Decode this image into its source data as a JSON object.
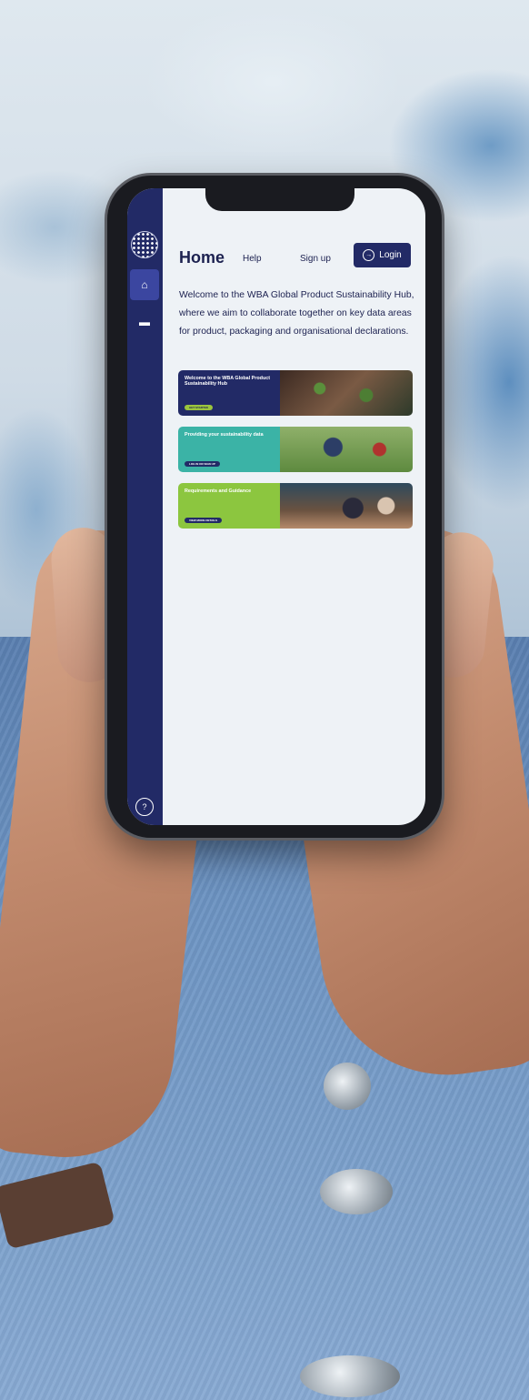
{
  "app": {
    "title": "Home",
    "nav": {
      "help": "Help",
      "signup": "Sign up",
      "login": "Login"
    },
    "welcome": "Welcome to the WBA Global Product Sustainability Hub, where we aim to collaborate together on key data areas for product, packaging and organisational declarations.",
    "sidebar": {
      "items": [
        {
          "icon": "home-icon",
          "active": true
        },
        {
          "icon": "document-icon",
          "active": false
        },
        {
          "icon": "help-circle-icon",
          "active": false
        }
      ]
    },
    "cards": [
      {
        "title": "Welcome to the WBA Global Product Sustainability Hub",
        "button": "GET STARTED",
        "color": "#222a66"
      },
      {
        "title": "Providing your sustainability data",
        "button": "LOG IN OR SIGN UP",
        "color": "#3bb3a6"
      },
      {
        "title": "Requirements and Guidance",
        "button": "VIEW MORE DETAILS",
        "color": "#8cc63f"
      }
    ]
  },
  "colors": {
    "sidebar": "#222a66",
    "accent_teal": "#3bb3a6",
    "accent_green": "#8cc63f",
    "screen_bg": "#eef2f6"
  }
}
